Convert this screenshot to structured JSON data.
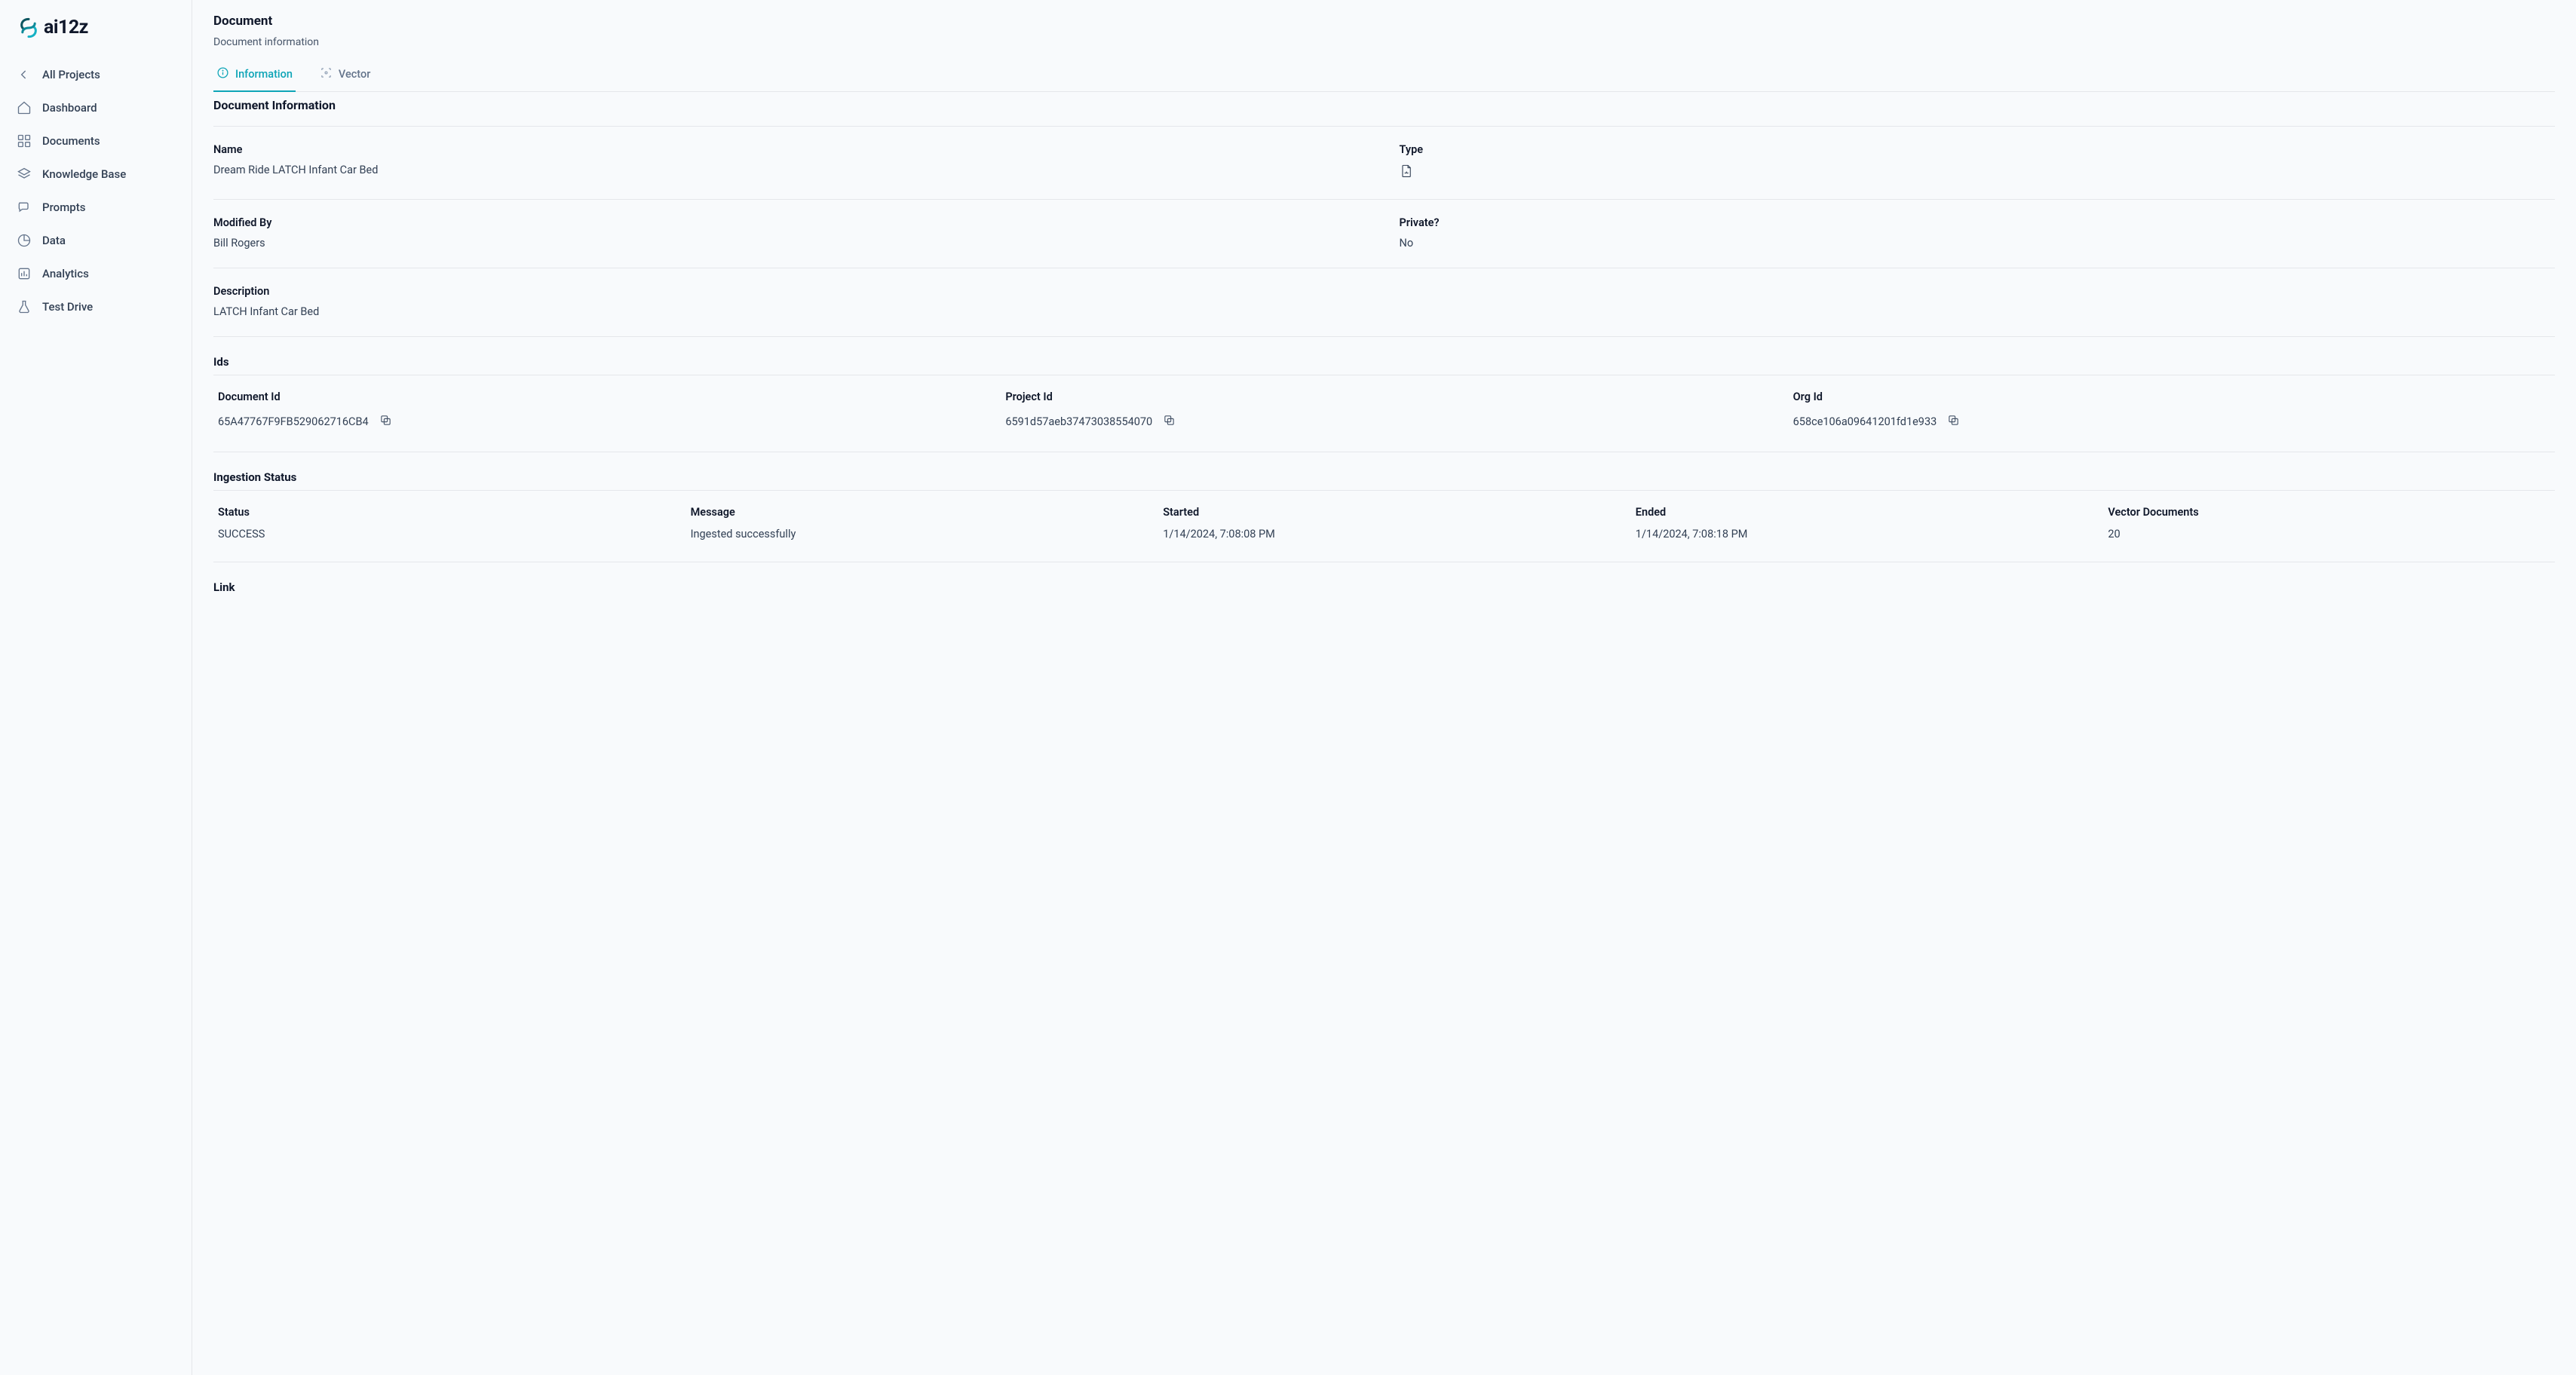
{
  "brand": {
    "name": "ai12z"
  },
  "sidebar": {
    "items": [
      {
        "label": "All Projects",
        "icon": "chevron-left"
      },
      {
        "label": "Dashboard",
        "icon": "home"
      },
      {
        "label": "Documents",
        "icon": "grid"
      },
      {
        "label": "Knowledge Base",
        "icon": "layers"
      },
      {
        "label": "Prompts",
        "icon": "chat"
      },
      {
        "label": "Data",
        "icon": "pie"
      },
      {
        "label": "Analytics",
        "icon": "bar"
      },
      {
        "label": "Test Drive",
        "icon": "flask"
      }
    ]
  },
  "header": {
    "title": "Document",
    "subtitle": "Document information"
  },
  "tabs": [
    {
      "label": "Information",
      "icon": "info",
      "active": true
    },
    {
      "label": "Vector",
      "icon": "scan",
      "active": false
    }
  ],
  "sections": {
    "doc_info_title": "Document Information",
    "ids_title": "Ids",
    "ingestion_title": "Ingestion Status",
    "link_title": "Link"
  },
  "doc": {
    "name_label": "Name",
    "name_value": "Dream Ride LATCH Infant Car Bed",
    "type_label": "Type",
    "type_value": "pdf",
    "modified_by_label": "Modified By",
    "modified_by_value": "Bill Rogers",
    "private_label": "Private?",
    "private_value": "No",
    "description_label": "Description",
    "description_value": "LATCH Infant Car Bed"
  },
  "ids": {
    "document_label": "Document Id",
    "document_value": "65A47767F9FB529062716CB4",
    "project_label": "Project Id",
    "project_value": "6591d57aeb37473038554070",
    "org_label": "Org Id",
    "org_value": "658ce106a09641201fd1e933"
  },
  "ingestion": {
    "status_label": "Status",
    "status_value": "SUCCESS",
    "message_label": "Message",
    "message_value": "Ingested successfully",
    "started_label": "Started",
    "started_value": "1/14/2024, 7:08:08 PM",
    "ended_label": "Ended",
    "ended_value": "1/14/2024, 7:08:18 PM",
    "vector_docs_label": "Vector Documents",
    "vector_docs_value": "20"
  }
}
